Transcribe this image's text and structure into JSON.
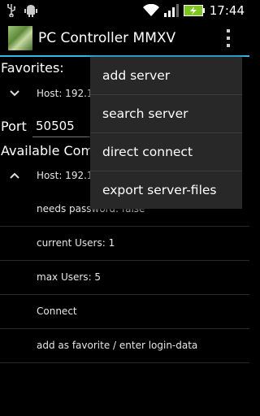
{
  "status_bar": {
    "time": "17:44",
    "icons": [
      "usb-icon",
      "android-debug-icon",
      "wifi-icon",
      "signal-icon",
      "battery-charging-icon"
    ]
  },
  "action_bar": {
    "title": "PC Controller MMXV",
    "overflow_icon": "more-vert-icon"
  },
  "favorites": {
    "label": "Favorites:",
    "host_text": "Host: 192.1"
  },
  "port": {
    "label": "Port",
    "value": "50505"
  },
  "available": {
    "label": "Available Com",
    "host_text": "Host: 192.1",
    "details": [
      "needs password: false",
      "current Users: 1",
      "max Users: 5",
      "Connect",
      "add as favorite / enter login-data"
    ]
  },
  "overflow_menu": {
    "items": [
      "add server",
      "search server",
      "direct connect",
      "export server-files"
    ]
  },
  "colors": {
    "accent": "#33b5e5",
    "menu_bg": "#282828",
    "background": "#000000"
  }
}
